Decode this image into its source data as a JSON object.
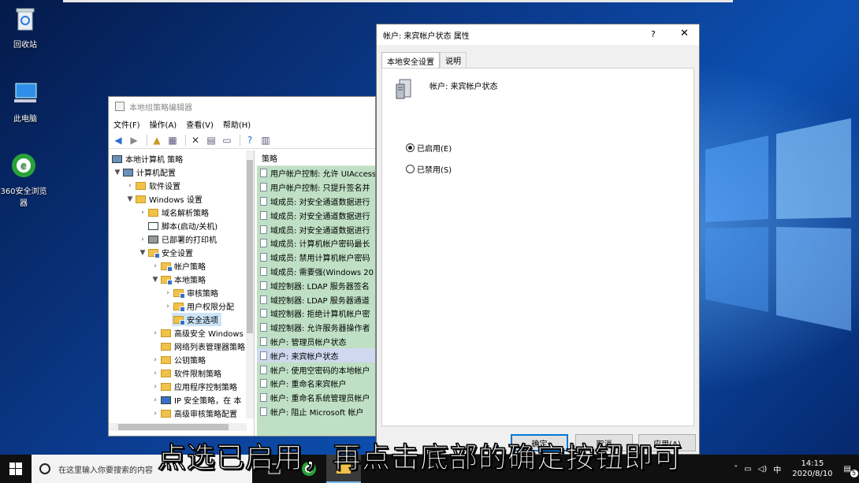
{
  "desktop": {
    "icons": [
      {
        "label": "回收站"
      },
      {
        "label": "此电脑"
      },
      {
        "label": "360安全浏览器"
      }
    ]
  },
  "gpe": {
    "title": "本地组策略编辑器",
    "menu": [
      "文件(F)",
      "操作(A)",
      "查看(V)",
      "帮助(H)"
    ],
    "tree": [
      {
        "label": "本地计算机 策略"
      },
      {
        "label": "计算机配置"
      },
      {
        "label": "软件设置"
      },
      {
        "label": "Windows 设置"
      },
      {
        "label": "域名解析策略"
      },
      {
        "label": "脚本(启动/关机)"
      },
      {
        "label": "已部署的打印机"
      },
      {
        "label": "安全设置"
      },
      {
        "label": "帐户策略"
      },
      {
        "label": "本地策略"
      },
      {
        "label": "审核策略"
      },
      {
        "label": "用户权限分配"
      },
      {
        "label": "安全选项"
      },
      {
        "label": "高级安全 Windows"
      },
      {
        "label": "网络列表管理器策略"
      },
      {
        "label": "公钥策略"
      },
      {
        "label": "软件限制策略"
      },
      {
        "label": "应用程序控制策略"
      },
      {
        "label": "IP 安全策略，在 本"
      },
      {
        "label": "高级审核策略配置"
      }
    ],
    "list_header": "策略",
    "list": [
      "用户帐户控制: 允许 UIAccess",
      "用户帐户控制: 只提升签名并",
      "域成员: 对安全通道数据进行",
      "域成员: 对安全通道数据进行",
      "域成员: 对安全通道数据进行",
      "域成员: 计算机帐户密码最长",
      "域成员: 禁用计算机帐户密码",
      "域成员: 需要强(Windows 20",
      "域控制器: LDAP 服务器签名",
      "域控制器: LDAP 服务器通道",
      "域控制器: 拒绝计算机帐户密",
      "域控制器: 允许服务器操作者",
      "帐户: 管理员帐户状态",
      "帐户: 来宾帐户状态",
      "帐户: 使用空密码的本地帐户",
      "帐户: 重命名来宾帐户",
      "帐户: 重命名系统管理员帐户",
      "帐户: 阻止 Microsoft 帐户"
    ]
  },
  "dialog": {
    "title": "帐户: 来宾帐户状态 属性",
    "help": "?",
    "close": "✕",
    "tabs": [
      "本地安全设置",
      "说明"
    ],
    "policy_name": "帐户: 来宾帐户状态",
    "radio_enabled": "已启用(E)",
    "radio_disabled": "已禁用(S)",
    "selected": "enabled",
    "buttons": {
      "ok": "确定",
      "cancel": "取消",
      "apply": "应用(A)"
    }
  },
  "subtitle": "点选已启用，再点击底部的确定按钮即可",
  "taskbar": {
    "search_placeholder": "在这里输入你要搜索的内容",
    "tray_lang": "中",
    "time": "14:15",
    "date": "2020/8/10",
    "notification_count": "5"
  }
}
